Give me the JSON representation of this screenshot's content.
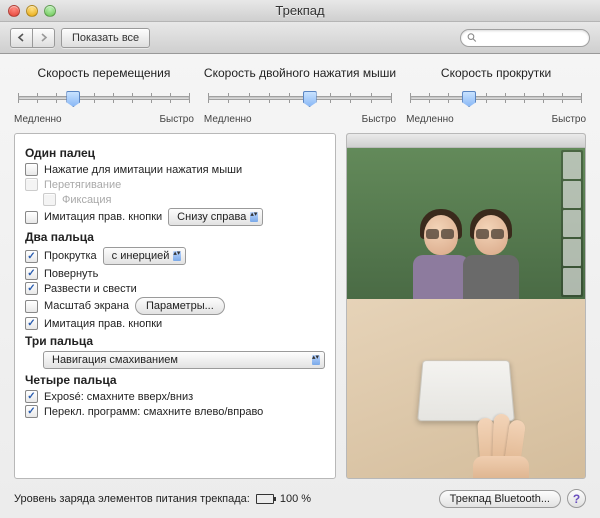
{
  "window": {
    "title": "Трекпад"
  },
  "toolbar": {
    "show_all": "Показать все",
    "search_placeholder": ""
  },
  "sliders": {
    "tracking": {
      "label": "Скорость перемещения",
      "min": "Медленно",
      "max": "Быстро",
      "value_pct": 33
    },
    "double_click": {
      "label": "Скорость двойного нажатия мыши",
      "min": "Медленно",
      "max": "Быстро",
      "value_pct": 55
    },
    "scroll": {
      "label": "Скорость прокрутки",
      "min": "Медленно",
      "max": "Быстро",
      "value_pct": 35
    }
  },
  "one_finger": {
    "heading": "Один палец",
    "tap_to_click": {
      "label": "Нажатие для имитации нажатия мыши",
      "checked": false
    },
    "dragging": {
      "label": "Перетягивание",
      "checked": false,
      "enabled": false
    },
    "drag_lock": {
      "label": "Фиксация",
      "checked": false,
      "enabled": false
    },
    "secondary_click": {
      "label": "Имитация прав. кнопки",
      "checked": false,
      "position": "Снизу справа"
    }
  },
  "two_fingers": {
    "heading": "Два пальца",
    "scroll": {
      "label": "Прокрутка",
      "checked": true,
      "mode": "с инерцией"
    },
    "rotate": {
      "label": "Повернуть",
      "checked": true
    },
    "pinch": {
      "label": "Развести и свести",
      "checked": true
    },
    "screen_zoom": {
      "label": "Масштаб экрана",
      "checked": false,
      "options_btn": "Параметры..."
    },
    "secondary_click": {
      "label": "Имитация прав. кнопки",
      "checked": true
    }
  },
  "three_fingers": {
    "heading": "Три пальца",
    "action": "Навигация смахиванием"
  },
  "four_fingers": {
    "heading": "Четыре пальца",
    "expose": {
      "label": "Exposé: смахните вверх/вниз",
      "checked": true
    },
    "app_switch": {
      "label": "Перекл. программ: смахните влево/вправо",
      "checked": true
    }
  },
  "footer": {
    "battery_label": "Уровень заряда элементов питания трекпада:",
    "battery_value": "100 %",
    "bluetooth_btn": "Трекпад Bluetooth...",
    "help": "?"
  }
}
